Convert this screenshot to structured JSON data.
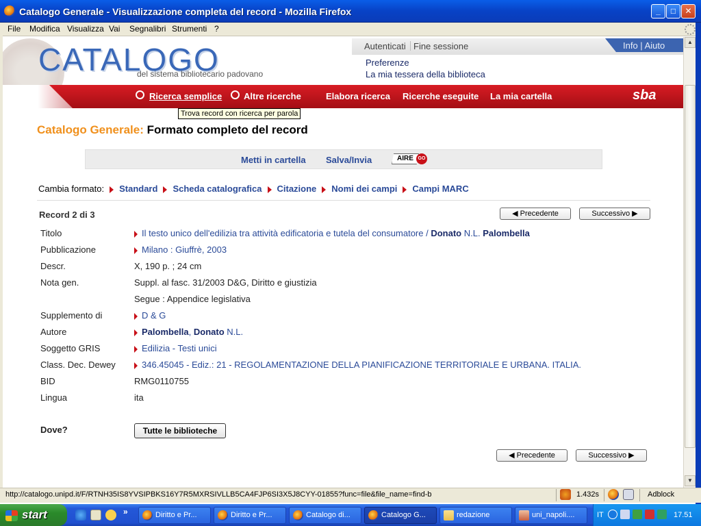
{
  "window": {
    "title": "Catalogo Generale - Visualizzazione completa del record - Mozilla Firefox"
  },
  "menu": [
    "File",
    "Modifica",
    "Visualizza",
    "Vai",
    "Segnalibri",
    "Strumenti",
    "?"
  ],
  "header": {
    "brand": "CATALOGO",
    "brand_sub": "del sistema bibliotecario padovano",
    "auth": "Autenticati",
    "logout": "Fine sessione",
    "info": "Info | Aiuto",
    "prefs": "Preferenze",
    "card": "La mia tessera della biblioteca",
    "sba": "sba"
  },
  "nav": {
    "items": [
      "Ricerca semplice",
      "Altre ricerche",
      "Elabora ricerca",
      "Ricerche eseguite",
      "La mia cartella"
    ],
    "tooltip": "Trova record con ricerca per parola"
  },
  "page": {
    "title_prefix": "Catalogo Generale:",
    "title": "Formato completo del record",
    "actions": [
      "Metti in cartella",
      "Salva/Invia"
    ],
    "aire_label": "AIRE",
    "go_label": "GO",
    "format_label": "Cambia formato:",
    "formats": [
      "Standard",
      "Scheda catalografica",
      "Citazione",
      "Nomi dei campi",
      "Campi MARC"
    ],
    "record_count": "Record 2 di 3",
    "prev": "◀ Precedente",
    "next": "Successivo ▶",
    "dove": "Dove?",
    "all_libraries": "Tutte le biblioteche"
  },
  "record": {
    "titolo_label": "Titolo",
    "titolo_text": "Il testo unico dell'edilizia tra attività edificatoria e tutela del consumatore /",
    "titolo_author_first": "Donato",
    "titolo_author_mid": "N.L.",
    "titolo_author_last": "Palombella",
    "pub_label": "Pubblicazione",
    "pub": "Milano : Giuffrè, 2003",
    "descr_label": "Descr.",
    "descr": "X, 190 p. ; 24 cm",
    "nota_label": "Nota gen.",
    "nota1": "Suppl. al fasc. 31/2003 D&G, Diritto e giustizia",
    "nota2": "Segue : Appendice legislativa",
    "suppl_label": "Supplemento di",
    "suppl": "D & G",
    "autore_label": "Autore",
    "autore_last": "Palombella",
    "autore_first": "Donato",
    "autore_mid": "N.L.",
    "sogg_label": "Soggetto GRIS",
    "sogg": "Edilizia - Testi unici",
    "dewey_label": "Class. Dec. Dewey",
    "dewey": "346.45045 - Ediz.: 21 - REGOLAMENTAZIONE DELLA PIANIFICAZIONE TERRITORIALE E URBANA. ITALIA.",
    "bid_label": "BID",
    "bid": "RMG0110755",
    "lingua_label": "Lingua",
    "lingua": "ita"
  },
  "status": {
    "url": "http://catalogo.unipd.it/F/RTNH35IS8YVSIPBKS16Y7R5MXRSIVLLB5CA4FJP6SI3X5J8CYY-01855?func=file&file_name=find-b",
    "timing": "1.432s",
    "adblock": "Adblock"
  },
  "taskbar": {
    "start": "start",
    "tasks": [
      "Diritto e Pr...",
      "Diritto e Pr...",
      "Catalogo di...",
      "Catalogo G...",
      "redazione",
      "uni_napoli...."
    ],
    "lang": "IT",
    "clock": "17.51"
  }
}
